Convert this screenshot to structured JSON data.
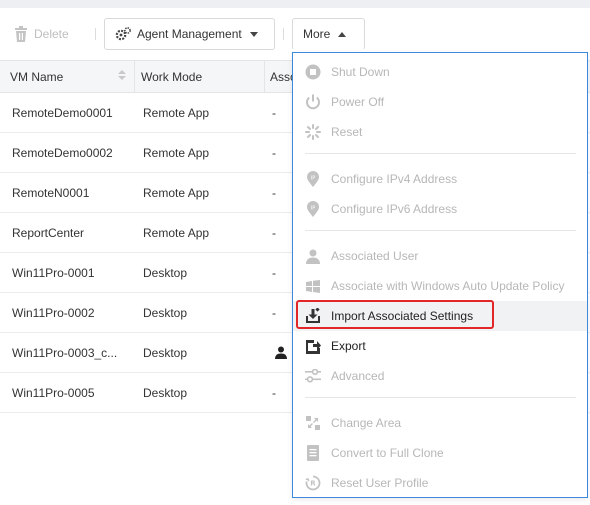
{
  "toolbar": {
    "delete_label": "Delete",
    "agent_management_label": "Agent Management",
    "more_label": "More"
  },
  "table": {
    "columns": [
      "VM Name",
      "Work Mode",
      "Asso"
    ],
    "rows": [
      {
        "vm_name": "RemoteDemo0001",
        "work_mode": "Remote App",
        "assoc": "-"
      },
      {
        "vm_name": "RemoteDemo0002",
        "work_mode": "Remote App",
        "assoc": "-"
      },
      {
        "vm_name": "RemoteN0001",
        "work_mode": "Remote App",
        "assoc": "-"
      },
      {
        "vm_name": "ReportCenter",
        "work_mode": "Remote App",
        "assoc": "-"
      },
      {
        "vm_name": "Win11Pro-0001",
        "work_mode": "Desktop",
        "assoc": "-"
      },
      {
        "vm_name": "Win11Pro-0002",
        "work_mode": "Desktop",
        "assoc": "-"
      },
      {
        "vm_name": "Win11Pro-0003_c...",
        "work_mode": "Desktop",
        "assoc": ""
      },
      {
        "vm_name": "Win11Pro-0005",
        "work_mode": "Desktop",
        "assoc": "-"
      }
    ]
  },
  "more_menu": {
    "items": [
      {
        "label": "Shut Down",
        "icon": "stop-circle-icon",
        "enabled": false
      },
      {
        "label": "Power Off",
        "icon": "power-icon",
        "enabled": false
      },
      {
        "label": "Reset",
        "icon": "spinner-icon",
        "enabled": false
      },
      {
        "label": "Configure IPv4 Address",
        "icon": "ip-pin-icon",
        "enabled": false
      },
      {
        "label": "Configure IPv6 Address",
        "icon": "ip-pin-icon",
        "enabled": false
      },
      {
        "label": "Associated User",
        "icon": "user-icon",
        "enabled": false
      },
      {
        "label": "Associate with Windows Auto Update Policy",
        "icon": "windows-icon",
        "enabled": false
      },
      {
        "label": "Import Associated Settings",
        "icon": "import-icon",
        "enabled": true
      },
      {
        "label": "Export",
        "icon": "export-icon",
        "enabled": true
      },
      {
        "label": "Advanced",
        "icon": "sliders-icon",
        "enabled": false
      },
      {
        "label": "Change Area",
        "icon": "change-area-icon",
        "enabled": false
      },
      {
        "label": "Convert to Full Clone",
        "icon": "document-icon",
        "enabled": false
      },
      {
        "label": "Reset User Profile",
        "icon": "reset-profile-icon",
        "enabled": false
      }
    ]
  },
  "colors": {
    "menu_border": "#3d87dd",
    "highlight": "#e3262a",
    "disabled_text": "#b7b7b7"
  }
}
